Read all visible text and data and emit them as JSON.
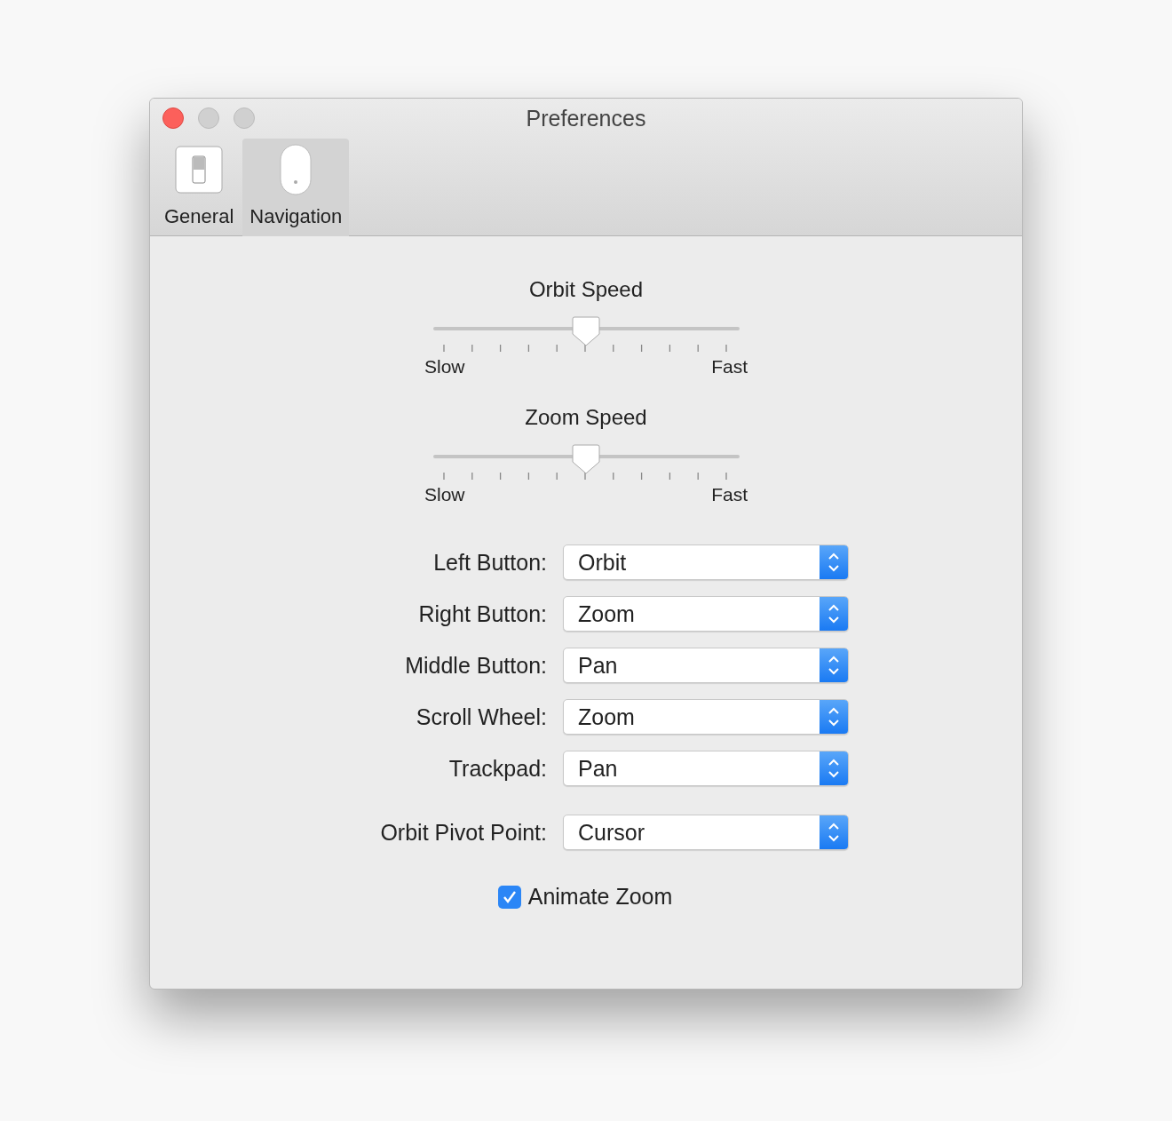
{
  "window": {
    "title": "Preferences"
  },
  "toolbar": [
    {
      "label": "General",
      "selected": false,
      "kind": "switch"
    },
    {
      "label": "Navigation",
      "selected": true,
      "kind": "mouse"
    }
  ],
  "sliders": [
    {
      "title": "Orbit Speed",
      "level": 0.5,
      "min_label": "Slow",
      "max_label": "Fast"
    },
    {
      "title": "Zoom Speed",
      "level": 0.5,
      "min_label": "Slow",
      "max_label": "Fast"
    }
  ],
  "popups": [
    {
      "label": "Left Button:",
      "value": "Orbit"
    },
    {
      "label": "Right Button:",
      "value": "Zoom"
    },
    {
      "label": "Middle Button:",
      "value": "Pan"
    },
    {
      "label": "Scroll Wheel:",
      "value": "Zoom"
    },
    {
      "label": "Trackpad:",
      "value": "Pan"
    }
  ],
  "pivot": {
    "label": "Orbit Pivot Point:",
    "value": "Cursor"
  },
  "checkbox": {
    "label": "Animate Zoom",
    "checked": true
  }
}
